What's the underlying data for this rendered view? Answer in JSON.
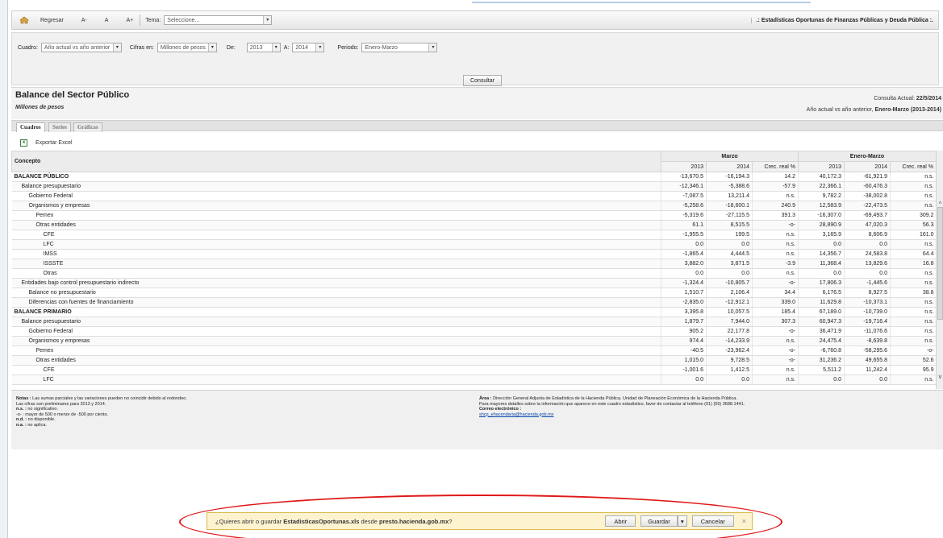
{
  "toolbar": {
    "back_label": "Regresar",
    "font_small": "A-",
    "font_normal": "A",
    "font_large": "A+",
    "tema_label": "Tema:",
    "tema_value": "Seleccione...",
    "title": ".: Estadísticas Oportunas de Finanzas Públicas y Deuda Pública :."
  },
  "filters": {
    "cuadro_label": "Cuadro:",
    "cuadro_value": "Año actual vs año anterior",
    "cifras_label": "Cifras en:",
    "cifras_value": "Millones de pesos",
    "de_label": "De:",
    "de_value": "2013",
    "a_label": "A:",
    "a_value": "2014",
    "periodo_label": "Periodo:",
    "periodo_value": "Enero-Marzo",
    "consult_button": "Consultar"
  },
  "header": {
    "title": "Balance del Sector Público",
    "subtitle": "Millones de pesos",
    "consulta_label": "Consulta Actual:",
    "consulta_date": "22/5/2014",
    "comparison_prefix": "Año actual vs año anterior,",
    "comparison_bold": "Enero-Marzo (2013-2014)"
  },
  "tabs": [
    "Cuadros",
    "Series",
    "Gráficas"
  ],
  "export_label": "Exportar Excel",
  "table": {
    "concept_header": "Concepto",
    "group1": "Marzo",
    "group2": "Enero-Marzo",
    "subheaders": [
      "2013",
      "2014",
      "Crec. real %",
      "2013",
      "2014",
      "Crec. real %"
    ],
    "rows": [
      {
        "c": "BALANCE PÚBLICO",
        "v": [
          "-13,670.5",
          "-16,194.3",
          "14.2",
          "40,172.3",
          "-61,921.9",
          "n.s."
        ]
      },
      {
        "c": "Balance presupuestario",
        "v": [
          "-12,346.1",
          "-5,388.6",
          "-57.9",
          "22,366.1",
          "-60,476.3",
          "n.s."
        ]
      },
      {
        "c": "Gobierno Federal",
        "v": [
          "-7,087.5",
          "13,211.4",
          "n.s.",
          "9,782.2",
          "-38,002.8",
          "n.s."
        ]
      },
      {
        "c": "Organismos y empresas",
        "v": [
          "-5,258.6",
          "-18,600.1",
          "240.9",
          "12,583.9",
          "-22,473.5",
          "n.s."
        ]
      },
      {
        "c": "Pemex",
        "v": [
          "-5,319.6",
          "-27,115.5",
          "391.3",
          "-16,307.0",
          "-69,493.7",
          "309.2"
        ]
      },
      {
        "c": "Otras entidades",
        "v": [
          "61.1",
          "8,515.5",
          "-o-",
          "28,890.9",
          "47,020.3",
          "56.3"
        ]
      },
      {
        "c": "CFE",
        "v": [
          "-1,955.5",
          "199.5",
          "n.s.",
          "3,165.9",
          "8,606.9",
          "161.0"
        ]
      },
      {
        "c": "LFC",
        "v": [
          "0.0",
          "0.0",
          "n.s.",
          "0.0",
          "0.0",
          "n.s."
        ]
      },
      {
        "c": "IMSS",
        "v": [
          "-1,865.4",
          "4,444.5",
          "n.s.",
          "14,356.7",
          "24,583.8",
          "64.4"
        ]
      },
      {
        "c": "ISSSTE",
        "v": [
          "3,882.0",
          "3,871.5",
          "-3.9",
          "11,368.4",
          "13,829.6",
          "16.8"
        ]
      },
      {
        "c": "Otras",
        "v": [
          "0.0",
          "0.0",
          "n.s.",
          "0.0",
          "0.0",
          "n.s."
        ]
      },
      {
        "c": "Entidades bajo control presupuestario indirecto",
        "v": [
          "-1,324.4",
          "-10,805.7",
          "-o-",
          "17,806.3",
          "-1,445.6",
          "n.s."
        ]
      },
      {
        "c": "Balance no presupuestario",
        "v": [
          "1,510.7",
          "2,106.4",
          "34.4",
          "6,176.5",
          "8,927.5",
          "38.8"
        ]
      },
      {
        "c": "Diferencias con fuentes de financiamiento",
        "v": [
          "-2,835.0",
          "-12,912.1",
          "339.0",
          "11,629.8",
          "-10,373.1",
          "n.s."
        ]
      },
      {
        "c": "BALANCE PRIMARIO",
        "v": [
          "3,395.8",
          "10,057.5",
          "185.4",
          "67,189.0",
          "-10,739.0",
          "n.s."
        ]
      },
      {
        "c": "Balance presupuestario",
        "v": [
          "1,879.7",
          "7,944.0",
          "307.3",
          "60,947.3",
          "-19,716.4",
          "n.s."
        ]
      },
      {
        "c": "Gobierno Federal",
        "v": [
          "905.2",
          "22,177.8",
          "-o-",
          "36,471.9",
          "-11,076.6",
          "n.s."
        ]
      },
      {
        "c": "Organismos y empresas",
        "v": [
          "974.4",
          "-14,233.9",
          "n.s.",
          "24,475.4",
          "-8,639.8",
          "n.s."
        ]
      },
      {
        "c": "Pemex",
        "v": [
          "-40.5",
          "-23,962.4",
          "-o-",
          "-6,760.8",
          "-58,295.6",
          "-o-"
        ]
      },
      {
        "c": "Otras entidades",
        "v": [
          "1,015.0",
          "9,728.5",
          "-o-",
          "31,236.2",
          "49,655.8",
          "52.6"
        ]
      },
      {
        "c": "CFE",
        "v": [
          "-1,001.6",
          "1,412.5",
          "n.s.",
          "5,511.2",
          "11,242.4",
          "95.9"
        ]
      },
      {
        "c": "LFC",
        "v": [
          "0.0",
          "0.0",
          "n.s.",
          "0.0",
          "0.0",
          "n.s."
        ]
      }
    ]
  },
  "notes": {
    "left": [
      {
        "b": "Notas :",
        "t": " Las sumas parciales y las variaciones pueden no coincidir debido al redondeo."
      },
      {
        "b": "",
        "t": "Las cifras son preliminares para 2013 y 2014."
      },
      {
        "b": "n.s. :",
        "t": " no significativo."
      },
      {
        "b": "",
        "t": "-o- : mayor de 500 o menor de -500 por ciento."
      },
      {
        "b": "n.d. :",
        "t": " no disponible."
      },
      {
        "b": "n.a. :",
        "t": " no aplica."
      }
    ],
    "right": [
      {
        "b": "Área :",
        "t": " Dirección General Adjunta de Estadística de la Hacienda Pública. Unidad de Planeación Económica de la Hacienda Pública."
      },
      {
        "b": "",
        "t": "Para mayores detalles sobre la información que aparece en este cuadro estadístico, favor de contactar al teléfono (01) (55) 3688.1441."
      },
      {
        "b": "Correo electrónico :",
        "t": ""
      }
    ],
    "email": "shcp_ehacendaria@hacienda.gob.mx"
  },
  "download": {
    "prefix": "¿Quieres abrir o guardar ",
    "filename": "EstadisticasOportunas.xls",
    "mid": " desde ",
    "host": "presto.hacienda.gob.mx",
    "suffix": "?",
    "open": "Abrir",
    "save": "Guardar",
    "cancel": "Cancelar"
  }
}
